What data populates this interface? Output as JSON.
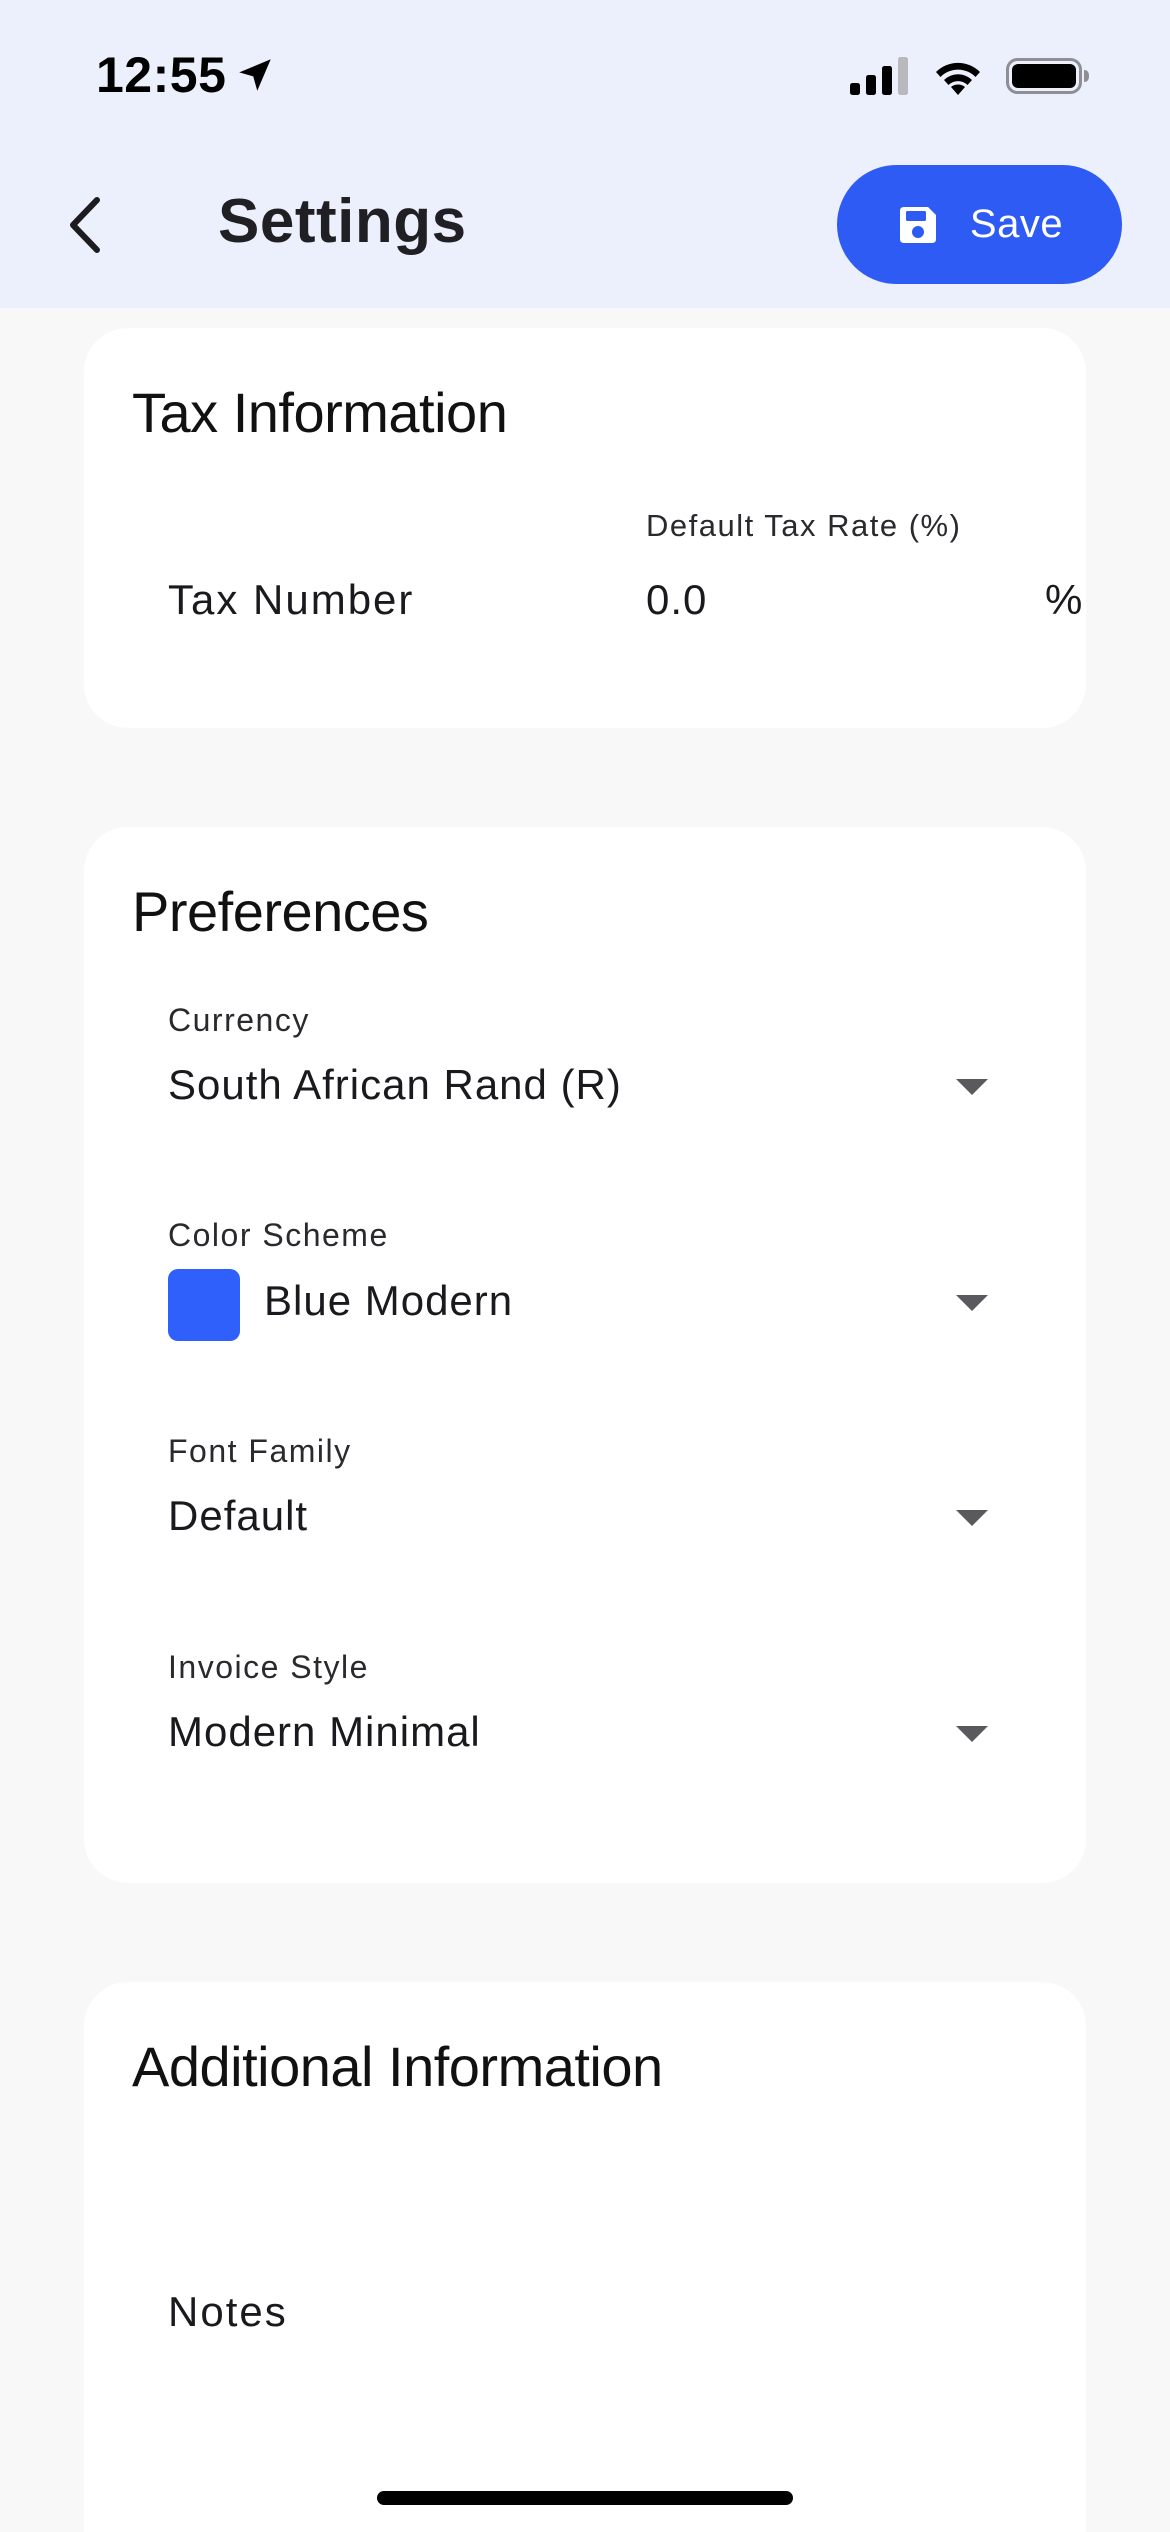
{
  "status_bar": {
    "time": "12:55"
  },
  "header": {
    "title": "Settings",
    "save_label": "Save",
    "accent_color": "#2f5bf5",
    "background_color": "#ecf0fd"
  },
  "tax_card": {
    "title": "Tax Information",
    "tax_number_placeholder": "Tax Number",
    "tax_rate_label": "Default Tax Rate (%)",
    "tax_rate_value": "0.0",
    "tax_rate_suffix": "%"
  },
  "preferences_card": {
    "title": "Preferences",
    "currency": {
      "label": "Currency",
      "value": "South African Rand (R)"
    },
    "color_scheme": {
      "label": "Color Scheme",
      "value": "Blue Modern",
      "swatch_color": "#3060fb"
    },
    "font_family": {
      "label": "Font Family",
      "value": "Default"
    },
    "invoice_style": {
      "label": "Invoice Style",
      "value": "Modern Minimal"
    }
  },
  "additional_card": {
    "title": "Additional Information",
    "notes_placeholder": "Notes"
  },
  "icons": [
    "location-arrow-icon",
    "signal-icon",
    "wifi-icon",
    "battery-icon",
    "back-chevron-icon",
    "save-disk-icon",
    "dropdown-arrow-icon"
  ]
}
